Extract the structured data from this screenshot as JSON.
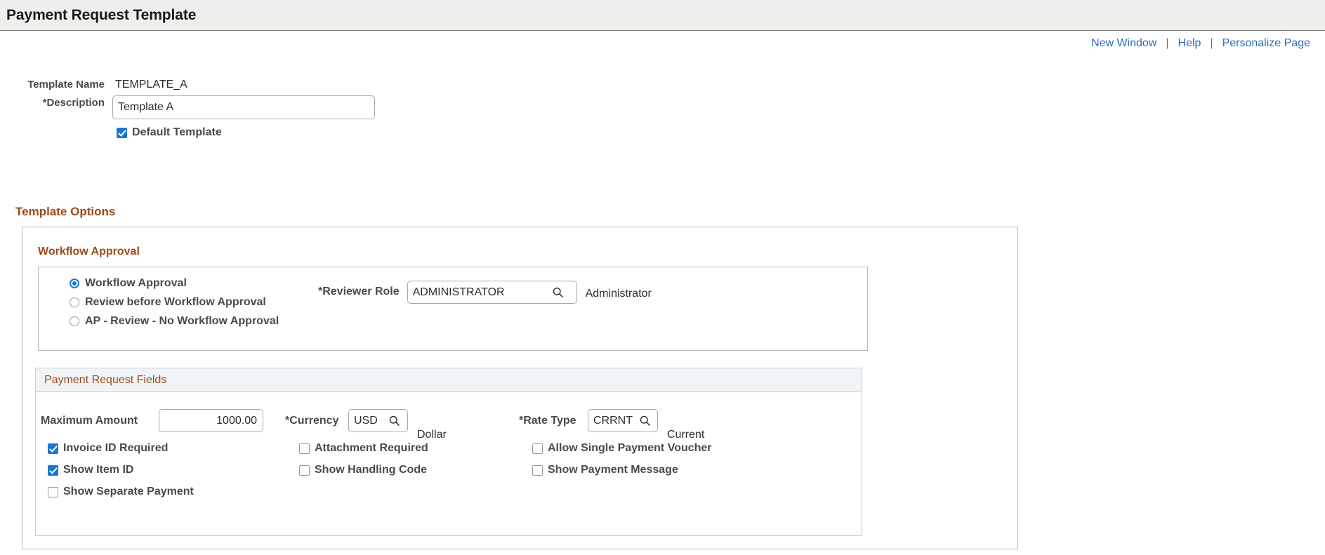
{
  "header": {
    "title": "Payment Request Template"
  },
  "utility_links": [
    {
      "label": "New Window",
      "icon": "new-window"
    },
    {
      "label": "Help",
      "icon": "help"
    },
    {
      "label": "Personalize Page",
      "icon": "personalize"
    }
  ],
  "separator": "|",
  "top_form": {
    "template_name_label": "Template Name",
    "template_name_value": "TEMPLATE_A",
    "description_label": "*Description",
    "description_value": "Template A",
    "description_placeholder": "",
    "default_template_label": "Default Template",
    "default_template_checked": true
  },
  "template_options": {
    "title": "Template Options",
    "workflow_approval": {
      "title": "Workflow Approval",
      "options": [
        {
          "label": "Workflow Approval",
          "selected": true
        },
        {
          "label": "Review before Workflow Approval",
          "selected": false
        },
        {
          "label": "AP - Review - No Workflow Approval",
          "selected": false
        }
      ],
      "reviewer_role_label": "*Reviewer Role",
      "reviewer_role_value": "ADMINISTRATOR",
      "reviewer_role_description": "Administrator",
      "lookup_icon": "search-icon"
    },
    "payment_request_fields": {
      "title": "Payment Request Fields",
      "maximum_amount_label": "Maximum Amount",
      "maximum_amount_value": "1000.00",
      "currency_label": "*Currency",
      "currency_value": "USD",
      "currency_description": "Dollar",
      "rate_type_label": "*Rate Type",
      "rate_type_value": "CRRNT",
      "rate_type_description": "Current",
      "checkboxes": [
        {
          "label": "Invoice ID Required",
          "checked": true
        },
        {
          "label": "Show Item ID",
          "checked": true
        },
        {
          "label": "Show Separate Payment",
          "checked": false
        },
        {
          "label": "Attachment Required",
          "checked": false
        },
        {
          "label": "Show Handling Code",
          "checked": false
        },
        {
          "label": "Allow Single Payment Voucher",
          "checked": false
        },
        {
          "label": "Show Payment Message",
          "checked": false
        }
      ]
    }
  },
  "colors": {
    "link": "#2a6ebb",
    "accent_heading": "#9c4a1c",
    "header_bg": "#efeeec",
    "control_accent": "#1977d4",
    "grid_header_bg": "#f0f4f6"
  }
}
